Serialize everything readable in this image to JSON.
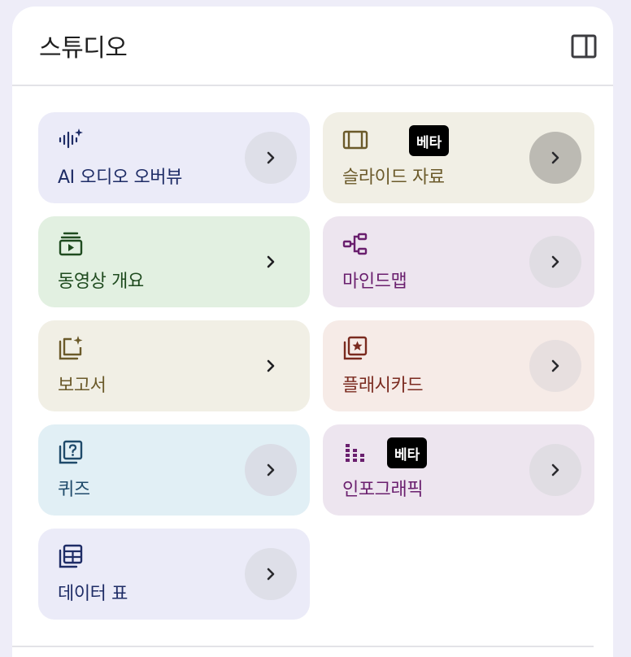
{
  "header": {
    "title": "스튜디오",
    "toggle_icon": "side-panel-icon"
  },
  "badge_label": "베타",
  "cards": [
    {
      "id": "audio-overview",
      "label": "AI 오디오 오버뷰",
      "icon": "audio-waveform-sparkle-icon",
      "bg": "#ebebf8",
      "fg": "#1e2c66",
      "arrow_bg": "#dedfe8"
    },
    {
      "id": "slides",
      "label": "슬라이드 자료",
      "icon": "slides-icon",
      "bg": "#f1efe5",
      "fg": "#6b5a2a",
      "arrow_bg": "#bcbab3",
      "badge": true
    },
    {
      "id": "video-overview",
      "label": "동영상 개요",
      "icon": "video-overview-icon",
      "bg": "#e2f0e1",
      "fg": "#1f4b1f",
      "arrow_bg": "transparent"
    },
    {
      "id": "mind-map",
      "label": "마인드맵",
      "icon": "mind-map-icon",
      "bg": "#ede5ef",
      "fg": "#6a1f6e",
      "arrow_bg": "#e0dde3"
    },
    {
      "id": "report",
      "label": "보고서",
      "icon": "report-sparkle-icon",
      "bg": "#f1efe5",
      "fg": "#6b5a2a",
      "arrow_bg": "transparent"
    },
    {
      "id": "flashcards",
      "label": "플래시카드",
      "icon": "flashcards-icon",
      "bg": "#f6ebe7",
      "fg": "#7a2a1f",
      "arrow_bg": "#e7dfdf"
    },
    {
      "id": "quiz",
      "label": "퀴즈",
      "icon": "quiz-icon",
      "bg": "#e1eff5",
      "fg": "#1f4a6a",
      "arrow_bg": "#dadde6"
    },
    {
      "id": "infographic",
      "label": "인포그래픽",
      "icon": "infographic-icon",
      "bg": "#ede5ef",
      "fg": "#6a1f6e",
      "arrow_bg": "#e0dde3",
      "badge": true
    },
    {
      "id": "data-table",
      "label": "데이터 표",
      "icon": "data-table-icon",
      "bg": "#ebebf8",
      "fg": "#1e2c66",
      "arrow_bg": "#dedfe8"
    }
  ]
}
